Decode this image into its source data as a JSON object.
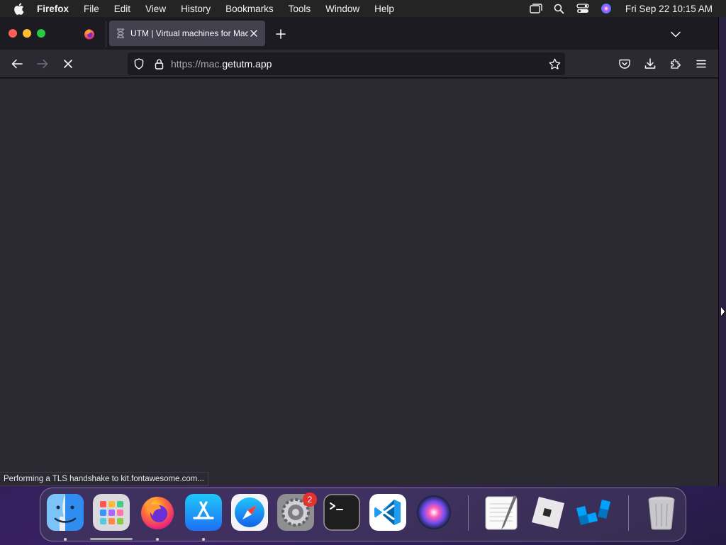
{
  "menubar": {
    "app_name": "Firefox",
    "items": [
      "File",
      "Edit",
      "View",
      "History",
      "Bookmarks",
      "Tools",
      "Window",
      "Help"
    ],
    "clock": "Fri Sep 22  10:15 AM",
    "status_icons": [
      "screen-mirroring-icon",
      "spotlight-search-icon",
      "control-center-icon",
      "siri-icon"
    ]
  },
  "browser": {
    "active_tab": {
      "title": "UTM | Virtual machines for Mac",
      "icon": "hourglass-icon"
    },
    "url": {
      "protocol": "https://mac.",
      "host": "getutm.app"
    },
    "status_text": "Performing a TLS handshake to kit.fontawesome.com...",
    "loading": true
  },
  "dock": {
    "apps": [
      "Finder",
      "Launchpad",
      "Firefox",
      "App Store",
      "Safari",
      "System Settings",
      "Terminal",
      "Visual Studio Code",
      "Siri",
      "TextEdit",
      "Roblox",
      "Roblox Studio",
      "Trash"
    ],
    "system_settings_badge": "2"
  },
  "colors": {
    "window_bg": "#1c1b22",
    "toolbar_bg": "#2b2a33",
    "tab_active_bg": "#42414d",
    "accent_red": "#ff5f57",
    "accent_yellow": "#febc2e",
    "accent_green": "#28c840"
  }
}
